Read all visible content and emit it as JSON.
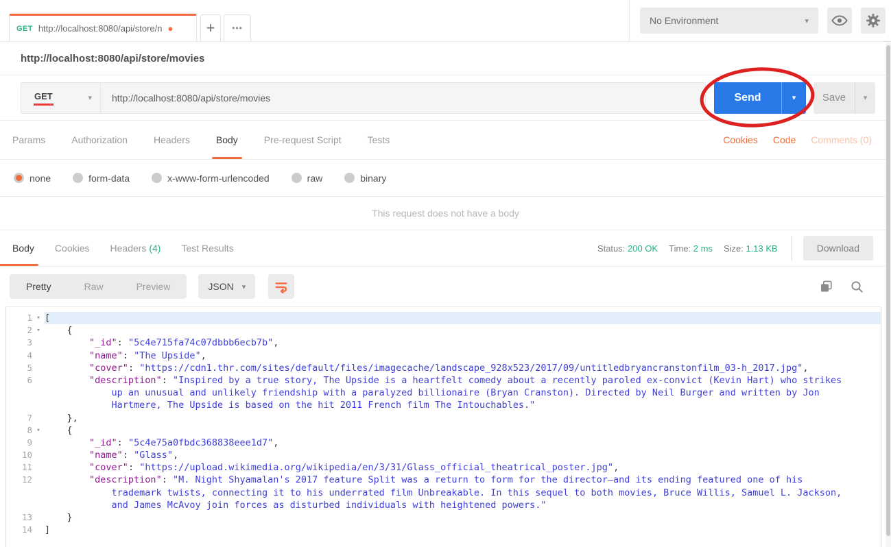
{
  "icons": {
    "chevron_down": "▾",
    "dot": "●",
    "fold": "▾"
  },
  "colors": {
    "accent_orange": "#f26b3a",
    "send_blue": "#2979e8",
    "status_green": "#26b47f",
    "annotation_red": "#dd2121"
  },
  "header": {
    "tab": {
      "method": "GET",
      "url": "http://localhost:8080/api/store/n"
    },
    "new_tab": "+",
    "tab_menu": "•••",
    "environment": "No Environment"
  },
  "request": {
    "title": "http://localhost:8080/api/store/movies",
    "method": "GET",
    "url": "http://localhost:8080/api/store/movies",
    "send": "Send",
    "save": "Save",
    "tabs": [
      {
        "label": "Params"
      },
      {
        "label": "Authorization"
      },
      {
        "label": "Headers"
      },
      {
        "label": "Body",
        "active": true
      },
      {
        "label": "Pre-request Script"
      },
      {
        "label": "Tests"
      }
    ],
    "links": {
      "cookies": "Cookies",
      "code": "Code",
      "comments": "Comments (0)"
    },
    "body_types": [
      {
        "label": "none",
        "selected": true
      },
      {
        "label": "form-data"
      },
      {
        "label": "x-www-form-urlencoded"
      },
      {
        "label": "raw"
      },
      {
        "label": "binary"
      }
    ],
    "empty_body": "This request does not have a body"
  },
  "response": {
    "tabs": [
      {
        "label": "Body",
        "active": true
      },
      {
        "label": "Cookies"
      },
      {
        "label": "Headers ",
        "count": "(4)"
      },
      {
        "label": "Test Results"
      }
    ],
    "meta": {
      "status_label": "Status:",
      "status": "200 OK",
      "time_label": "Time:",
      "time": "2 ms",
      "size_label": "Size:",
      "size": "1.13 KB",
      "download": "Download"
    },
    "toolbar": {
      "modes": [
        {
          "label": "Pretty",
          "active": true
        },
        {
          "label": "Raw"
        },
        {
          "label": "Preview"
        }
      ],
      "format": "JSON"
    },
    "code": {
      "rows": [
        {
          "n": "1",
          "fold": true,
          "hl": true,
          "seg": [
            {
              "c": "p",
              "t": "["
            }
          ]
        },
        {
          "n": "2",
          "fold": true,
          "seg": [
            {
              "c": "p",
              "t": "    {"
            }
          ]
        },
        {
          "n": "3",
          "seg": [
            {
              "c": "p",
              "t": "        "
            },
            {
              "c": "k",
              "t": "\"_id\""
            },
            {
              "c": "p",
              "t": ": "
            },
            {
              "c": "v",
              "t": "\"5c4e715fa74c07dbbb6ecb7b\""
            },
            {
              "c": "p",
              "t": ","
            }
          ]
        },
        {
          "n": "4",
          "seg": [
            {
              "c": "p",
              "t": "        "
            },
            {
              "c": "k",
              "t": "\"name\""
            },
            {
              "c": "p",
              "t": ": "
            },
            {
              "c": "v",
              "t": "\"The Upside\""
            },
            {
              "c": "p",
              "t": ","
            }
          ]
        },
        {
          "n": "5",
          "seg": [
            {
              "c": "p",
              "t": "        "
            },
            {
              "c": "k",
              "t": "\"cover\""
            },
            {
              "c": "p",
              "t": ": "
            },
            {
              "c": "v",
              "t": "\"https://cdn1.thr.com/sites/default/files/imagecache/landscape_928x523/2017/09/untitledbryancranstonfilm_03-h_2017.jpg\""
            },
            {
              "c": "p",
              "t": ","
            }
          ]
        },
        {
          "n": "6",
          "seg": [
            {
              "c": "p",
              "t": "        "
            },
            {
              "c": "k",
              "t": "\"description\""
            },
            {
              "c": "p",
              "t": ": "
            },
            {
              "c": "v",
              "t": "\"Inspired by a true story, The Upside is a heartfelt comedy about a recently paroled ex-convict (Kevin Hart) who strikes"
            }
          ]
        },
        {
          "seg": [
            {
              "c": "v",
              "t": "            up an unusual and unlikely friendship with a paralyzed billionaire (Bryan Cranston). Directed by Neil Burger and written by Jon"
            }
          ]
        },
        {
          "seg": [
            {
              "c": "v",
              "t": "            Hartmere, The Upside is based on the hit 2011 French film The Intouchables.\""
            }
          ]
        },
        {
          "n": "7",
          "seg": [
            {
              "c": "p",
              "t": "    },"
            }
          ]
        },
        {
          "n": "8",
          "fold": true,
          "seg": [
            {
              "c": "p",
              "t": "    {"
            }
          ]
        },
        {
          "n": "9",
          "seg": [
            {
              "c": "p",
              "t": "        "
            },
            {
              "c": "k",
              "t": "\"_id\""
            },
            {
              "c": "p",
              "t": ": "
            },
            {
              "c": "v",
              "t": "\"5c4e75a0fbdc368838eee1d7\""
            },
            {
              "c": "p",
              "t": ","
            }
          ]
        },
        {
          "n": "10",
          "seg": [
            {
              "c": "p",
              "t": "        "
            },
            {
              "c": "k",
              "t": "\"name\""
            },
            {
              "c": "p",
              "t": ": "
            },
            {
              "c": "v",
              "t": "\"Glass\""
            },
            {
              "c": "p",
              "t": ","
            }
          ]
        },
        {
          "n": "11",
          "seg": [
            {
              "c": "p",
              "t": "        "
            },
            {
              "c": "k",
              "t": "\"cover\""
            },
            {
              "c": "p",
              "t": ": "
            },
            {
              "c": "v",
              "t": "\"https://upload.wikimedia.org/wikipedia/en/3/31/Glass_official_theatrical_poster.jpg\""
            },
            {
              "c": "p",
              "t": ","
            }
          ]
        },
        {
          "n": "12",
          "seg": [
            {
              "c": "p",
              "t": "        "
            },
            {
              "c": "k",
              "t": "\"description\""
            },
            {
              "c": "p",
              "t": ": "
            },
            {
              "c": "v",
              "t": "\"M. Night Shyamalan's 2017 feature Split was a return to form for the director—and its ending featured one of his"
            }
          ]
        },
        {
          "seg": [
            {
              "c": "v",
              "t": "            trademark twists, connecting it to his underrated film Unbreakable. In this sequel to both movies, Bruce Willis, Samuel L. Jackson,"
            }
          ]
        },
        {
          "seg": [
            {
              "c": "v",
              "t": "            and James McAvoy join forces as disturbed individuals with heightened powers.\""
            }
          ]
        },
        {
          "n": "13",
          "seg": [
            {
              "c": "p",
              "t": "    }"
            }
          ]
        },
        {
          "n": "14",
          "seg": [
            {
              "c": "p",
              "t": "]"
            }
          ]
        }
      ]
    }
  }
}
